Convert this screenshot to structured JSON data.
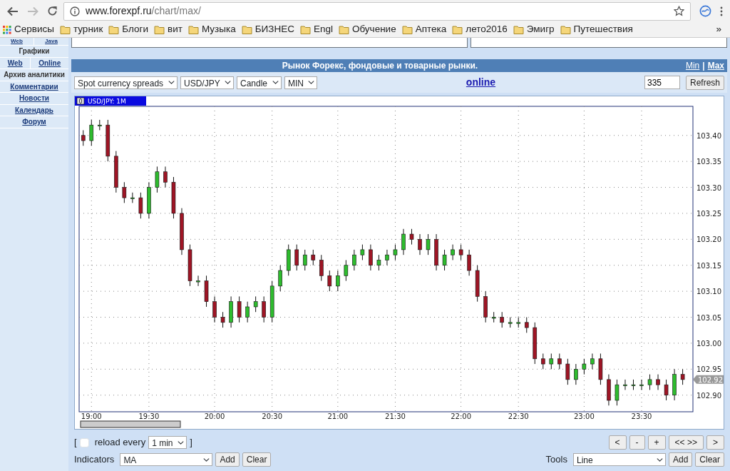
{
  "browser": {
    "url_host": "www.forexpf.ru",
    "url_path": "/chart/max/",
    "back_disabled": false,
    "forward_disabled": true,
    "bookmarks": [
      {
        "kind": "apps",
        "label": "Сервисы"
      },
      {
        "kind": "folder",
        "label": "турник"
      },
      {
        "kind": "folder",
        "label": "Блоги"
      },
      {
        "kind": "folder",
        "label": "вит"
      },
      {
        "kind": "folder",
        "label": "Музыка"
      },
      {
        "kind": "folder",
        "label": "БИЗНЕС"
      },
      {
        "kind": "folder",
        "label": "Engl"
      },
      {
        "kind": "folder",
        "label": "Обучение"
      },
      {
        "kind": "folder",
        "label": "Аптека"
      },
      {
        "kind": "folder",
        "label": "лето2016"
      },
      {
        "kind": "folder",
        "label": "Эмигр"
      },
      {
        "kind": "folder",
        "label": "Путешествия"
      }
    ],
    "more": "»"
  },
  "sidebar": {
    "items": [
      {
        "kind": "pair",
        "links": [
          "Web",
          "Java"
        ]
      },
      {
        "kind": "heading",
        "label": "Графики"
      },
      {
        "kind": "pair",
        "links": [
          "Web",
          "Online"
        ]
      },
      {
        "kind": "heading",
        "label": "Архив аналитики"
      },
      {
        "kind": "link",
        "label": "Комментарии"
      },
      {
        "kind": "link",
        "label": "Новости"
      },
      {
        "kind": "link",
        "label": "Календарь"
      },
      {
        "kind": "link",
        "label": "Форум"
      }
    ]
  },
  "panel": {
    "title": "Рынок Форекс, фондовые и товарные рынки.",
    "size_links": [
      "Min",
      "Max"
    ],
    "separator": "|",
    "selects": [
      "Spot currency spreads",
      "USD/JPY",
      "Candle",
      "MIN"
    ],
    "online_link": "online",
    "count_value": "335",
    "refresh_button": "Refresh"
  },
  "chart": {
    "tab_index": "0",
    "tab_label": "USD/JPY: 1M",
    "last_price_label": "102.92",
    "chart_data": {
      "type": "candlestick",
      "grid": true,
      "ylim": [
        102.868,
        103.456
      ],
      "categories": [
        null,
        "19:00",
        null,
        null,
        null,
        null,
        null,
        null,
        "19:30",
        null,
        null,
        null,
        null,
        null,
        null,
        null,
        "20:00",
        null,
        null,
        null,
        null,
        null,
        null,
        "20:30",
        null,
        null,
        null,
        null,
        null,
        null,
        null,
        "21:00",
        null,
        null,
        null,
        null,
        null,
        null,
        "21:30",
        null,
        null,
        null,
        null,
        null,
        null,
        null,
        "22:00",
        null,
        null,
        null,
        null,
        null,
        null,
        "22:30",
        null,
        null,
        null,
        null,
        null,
        null,
        null,
        "23:00",
        null,
        null,
        null,
        null,
        null,
        null,
        "23:30",
        null,
        null,
        null,
        null,
        null
      ],
      "yticks": [
        {
          "value": 103.4,
          "label": "103.40"
        },
        {
          "value": 103.35,
          "label": "103.35"
        },
        {
          "value": 103.3,
          "label": "103.30"
        },
        {
          "value": 103.25,
          "label": "103.25"
        },
        {
          "value": 103.2,
          "label": "103.20"
        },
        {
          "value": 103.15,
          "label": "103.15"
        },
        {
          "value": 103.1,
          "label": "103.10"
        },
        {
          "value": 103.05,
          "label": "103.05"
        },
        {
          "value": 103.0,
          "label": "103.00"
        },
        {
          "value": 102.95,
          "label": "102.95"
        },
        {
          "value": 102.9,
          "label": "102.90"
        }
      ],
      "ohlc": [
        [
          103.4,
          103.41,
          103.38,
          103.39
        ],
        [
          103.39,
          103.43,
          103.38,
          103.42
        ],
        [
          103.42,
          103.43,
          103.41,
          103.42
        ],
        [
          103.42,
          103.43,
          103.35,
          103.36
        ],
        [
          103.36,
          103.37,
          103.29,
          103.3
        ],
        [
          103.3,
          103.31,
          103.27,
          103.28
        ],
        [
          103.28,
          103.29,
          103.27,
          103.28
        ],
        [
          103.28,
          103.29,
          103.24,
          103.25
        ],
        [
          103.25,
          103.31,
          103.24,
          103.3
        ],
        [
          103.3,
          103.34,
          103.29,
          103.33
        ],
        [
          103.33,
          103.34,
          103.3,
          103.31
        ],
        [
          103.31,
          103.32,
          103.24,
          103.25
        ],
        [
          103.25,
          103.26,
          103.17,
          103.18
        ],
        [
          103.18,
          103.19,
          103.11,
          103.12
        ],
        [
          103.12,
          103.13,
          103.11,
          103.12
        ],
        [
          103.12,
          103.13,
          103.07,
          103.08
        ],
        [
          103.08,
          103.09,
          103.04,
          103.05
        ],
        [
          103.05,
          103.06,
          103.03,
          103.04
        ],
        [
          103.04,
          103.09,
          103.03,
          103.08
        ],
        [
          103.08,
          103.09,
          103.04,
          103.05
        ],
        [
          103.05,
          103.08,
          103.04,
          103.07
        ],
        [
          103.07,
          103.09,
          103.06,
          103.08
        ],
        [
          103.08,
          103.09,
          103.04,
          103.05
        ],
        [
          103.05,
          103.12,
          103.04,
          103.11
        ],
        [
          103.11,
          103.15,
          103.1,
          103.14
        ],
        [
          103.14,
          103.19,
          103.13,
          103.18
        ],
        [
          103.18,
          103.19,
          103.14,
          103.15
        ],
        [
          103.15,
          103.18,
          103.14,
          103.17
        ],
        [
          103.17,
          103.18,
          103.15,
          103.16
        ],
        [
          103.16,
          103.17,
          103.12,
          103.13
        ],
        [
          103.13,
          103.14,
          103.1,
          103.11
        ],
        [
          103.11,
          103.14,
          103.1,
          103.13
        ],
        [
          103.13,
          103.16,
          103.12,
          103.15
        ],
        [
          103.15,
          103.18,
          103.14,
          103.17
        ],
        [
          103.17,
          103.19,
          103.16,
          103.18
        ],
        [
          103.18,
          103.19,
          103.14,
          103.15
        ],
        [
          103.15,
          103.17,
          103.14,
          103.16
        ],
        [
          103.16,
          103.18,
          103.15,
          103.17
        ],
        [
          103.17,
          103.19,
          103.16,
          103.18
        ],
        [
          103.18,
          103.22,
          103.17,
          103.21
        ],
        [
          103.21,
          103.22,
          103.19,
          103.2
        ],
        [
          103.2,
          103.21,
          103.17,
          103.18
        ],
        [
          103.18,
          103.21,
          103.17,
          103.2
        ],
        [
          103.2,
          103.21,
          103.14,
          103.15
        ],
        [
          103.15,
          103.18,
          103.14,
          103.17
        ],
        [
          103.17,
          103.19,
          103.16,
          103.18
        ],
        [
          103.18,
          103.19,
          103.16,
          103.17
        ],
        [
          103.17,
          103.18,
          103.13,
          103.14
        ],
        [
          103.14,
          103.15,
          103.08,
          103.09
        ],
        [
          103.09,
          103.1,
          103.04,
          103.05
        ],
        [
          103.05,
          103.06,
          103.04,
          103.05
        ],
        [
          103.05,
          103.06,
          103.03,
          103.04
        ],
        [
          103.04,
          103.05,
          103.03,
          103.04
        ],
        [
          103.04,
          103.05,
          103.03,
          103.04
        ],
        [
          103.04,
          103.05,
          103.02,
          103.03
        ],
        [
          103.03,
          103.04,
          102.96,
          102.97
        ],
        [
          102.97,
          102.98,
          102.95,
          102.96
        ],
        [
          102.96,
          102.98,
          102.95,
          102.97
        ],
        [
          102.97,
          102.98,
          102.95,
          102.96
        ],
        [
          102.96,
          102.97,
          102.92,
          102.93
        ],
        [
          102.93,
          102.96,
          102.92,
          102.95
        ],
        [
          102.95,
          102.97,
          102.94,
          102.96
        ],
        [
          102.96,
          102.98,
          102.95,
          102.97
        ],
        [
          102.97,
          102.98,
          102.92,
          102.93
        ],
        [
          102.93,
          102.94,
          102.88,
          102.89
        ],
        [
          102.89,
          102.93,
          102.88,
          102.92
        ],
        [
          102.92,
          102.93,
          102.91,
          102.92
        ],
        [
          102.92,
          102.93,
          102.91,
          102.92
        ],
        [
          102.92,
          102.93,
          102.91,
          102.92
        ],
        [
          102.92,
          102.94,
          102.91,
          102.93
        ],
        [
          102.93,
          102.94,
          102.91,
          102.92
        ],
        [
          102.92,
          102.93,
          102.89,
          102.9
        ],
        [
          102.9,
          102.95,
          102.89,
          102.94
        ],
        [
          102.94,
          102.95,
          102.92,
          102.93
        ]
      ]
    }
  },
  "controls": {
    "open_bracket": "[",
    "reload_checked": false,
    "reload_label": "reload every",
    "reload_interval": "1 min",
    "close_bracket": "]",
    "nav_buttons": [
      "<",
      "-",
      "+",
      "<< >>",
      ">"
    ],
    "indicators_label": "Indicators",
    "indicator": "MA",
    "indicators_add": "Add",
    "indicators_clear": "Clear",
    "tools_label": "Tools",
    "tool": "Line",
    "tools_add": "Add",
    "tools_clear": "Clear"
  }
}
